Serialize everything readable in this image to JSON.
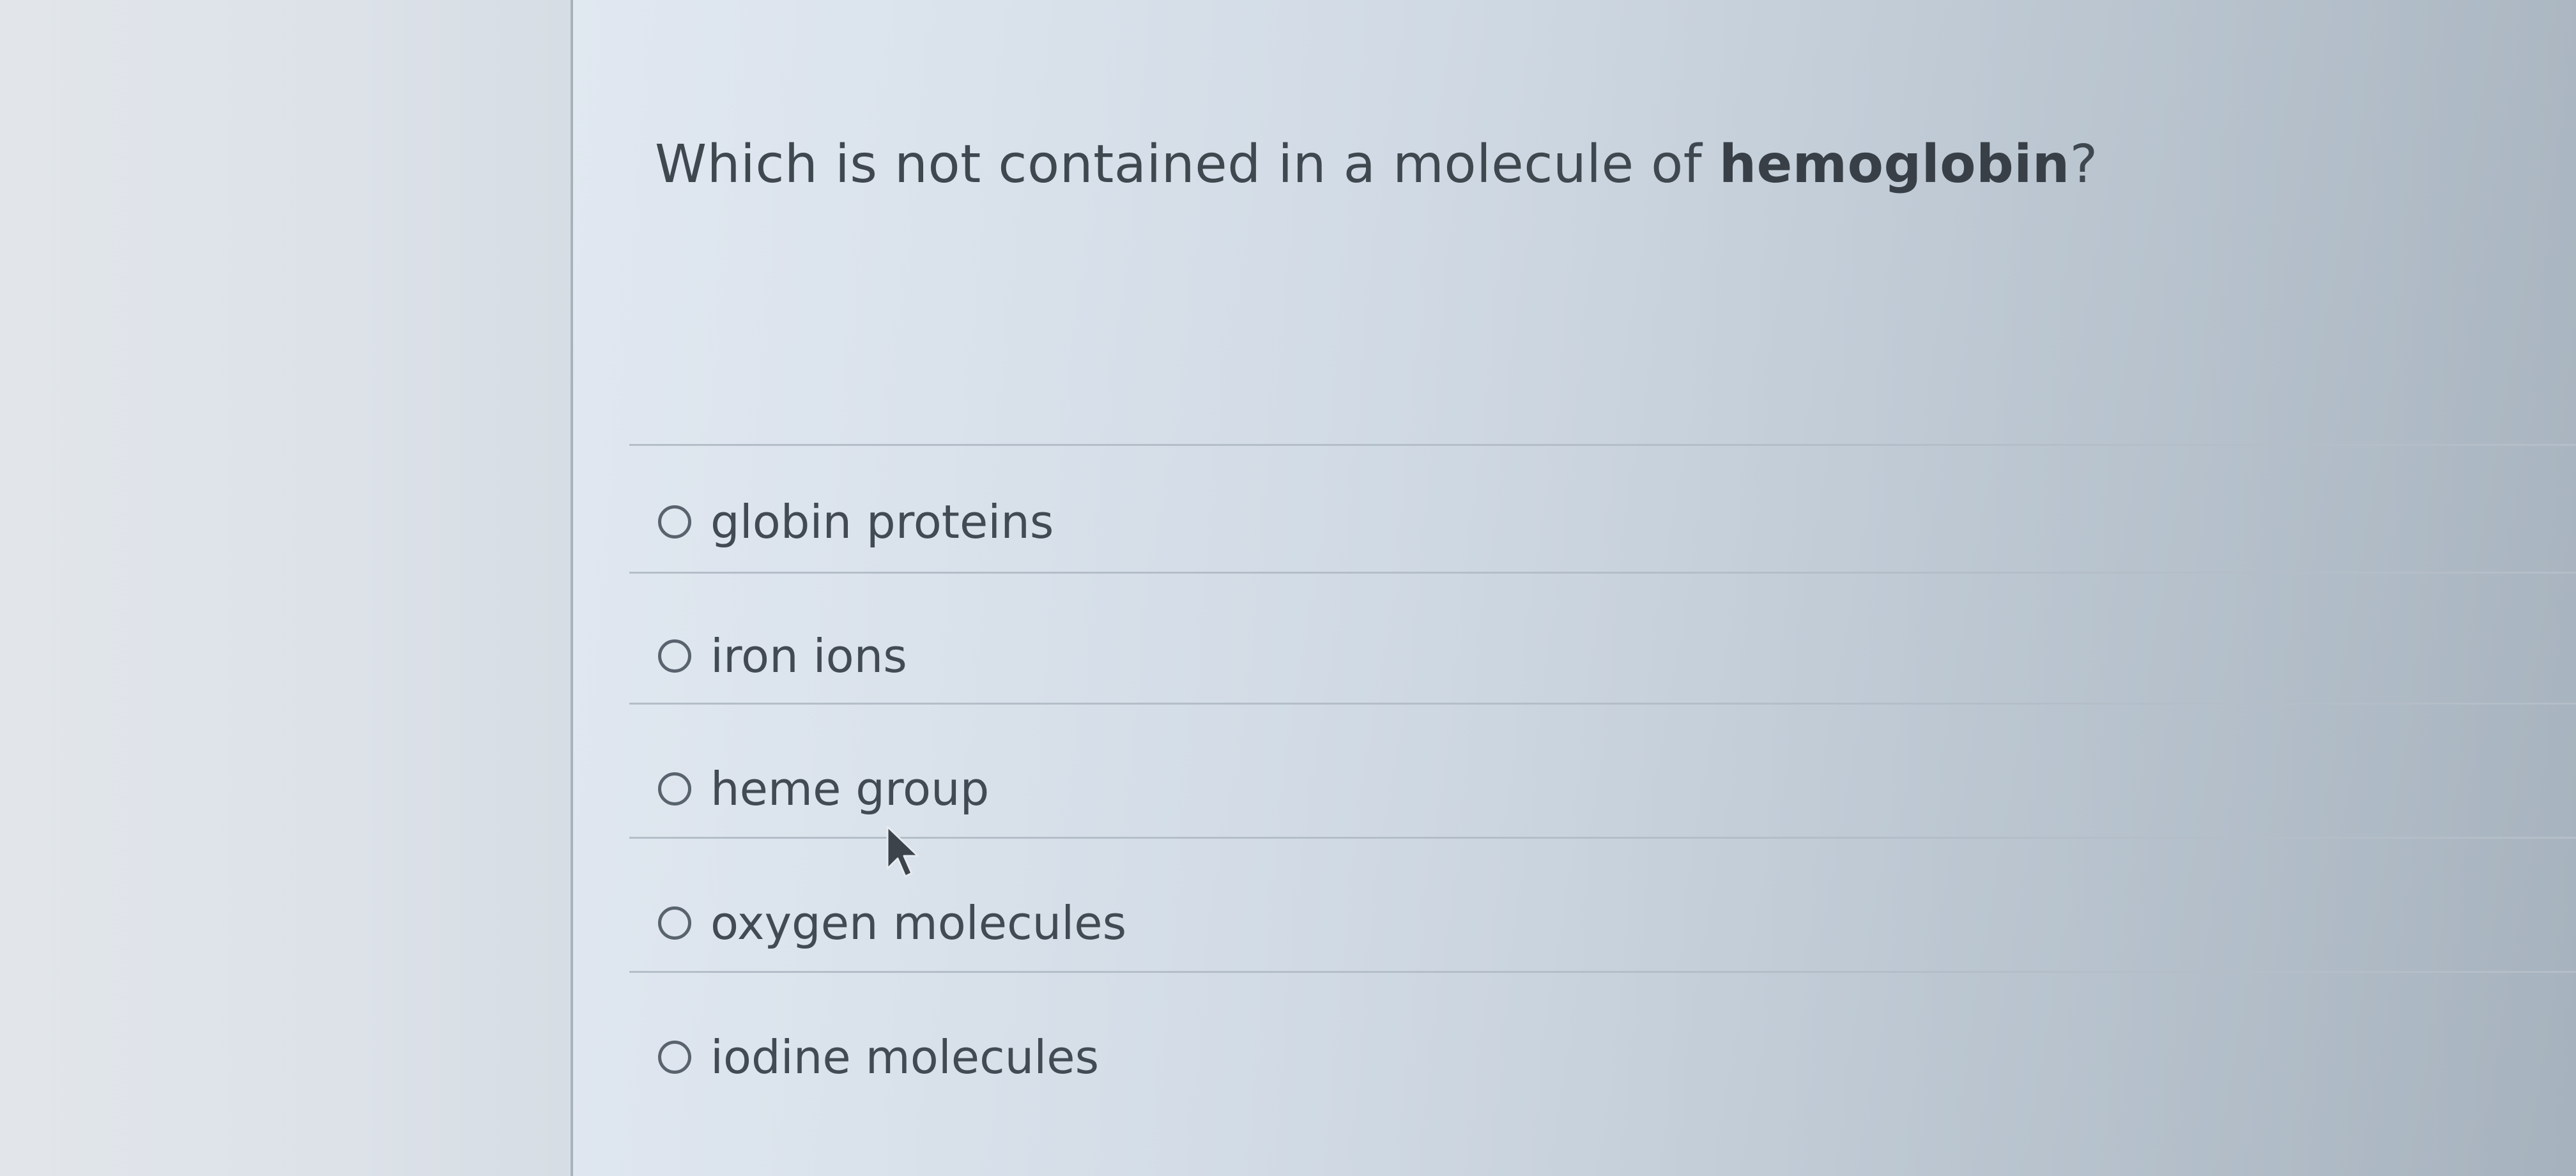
{
  "question": {
    "prefix": "Which is not contained in a molecule of ",
    "emphasis": "hemoglobin",
    "suffix": "?"
  },
  "options": [
    {
      "label": "globin proteins",
      "selected": false
    },
    {
      "label": "iron ions",
      "selected": false
    },
    {
      "label": "heme group",
      "selected": false
    },
    {
      "label": "oxygen molecules",
      "selected": false
    },
    {
      "label": "iodine molecules",
      "selected": false
    }
  ],
  "colors": {
    "text": "#3f474f",
    "radio_border": "#59636d",
    "divider": "#b4bec8"
  },
  "icons": {
    "cursor": "mouse-pointer-icon"
  }
}
